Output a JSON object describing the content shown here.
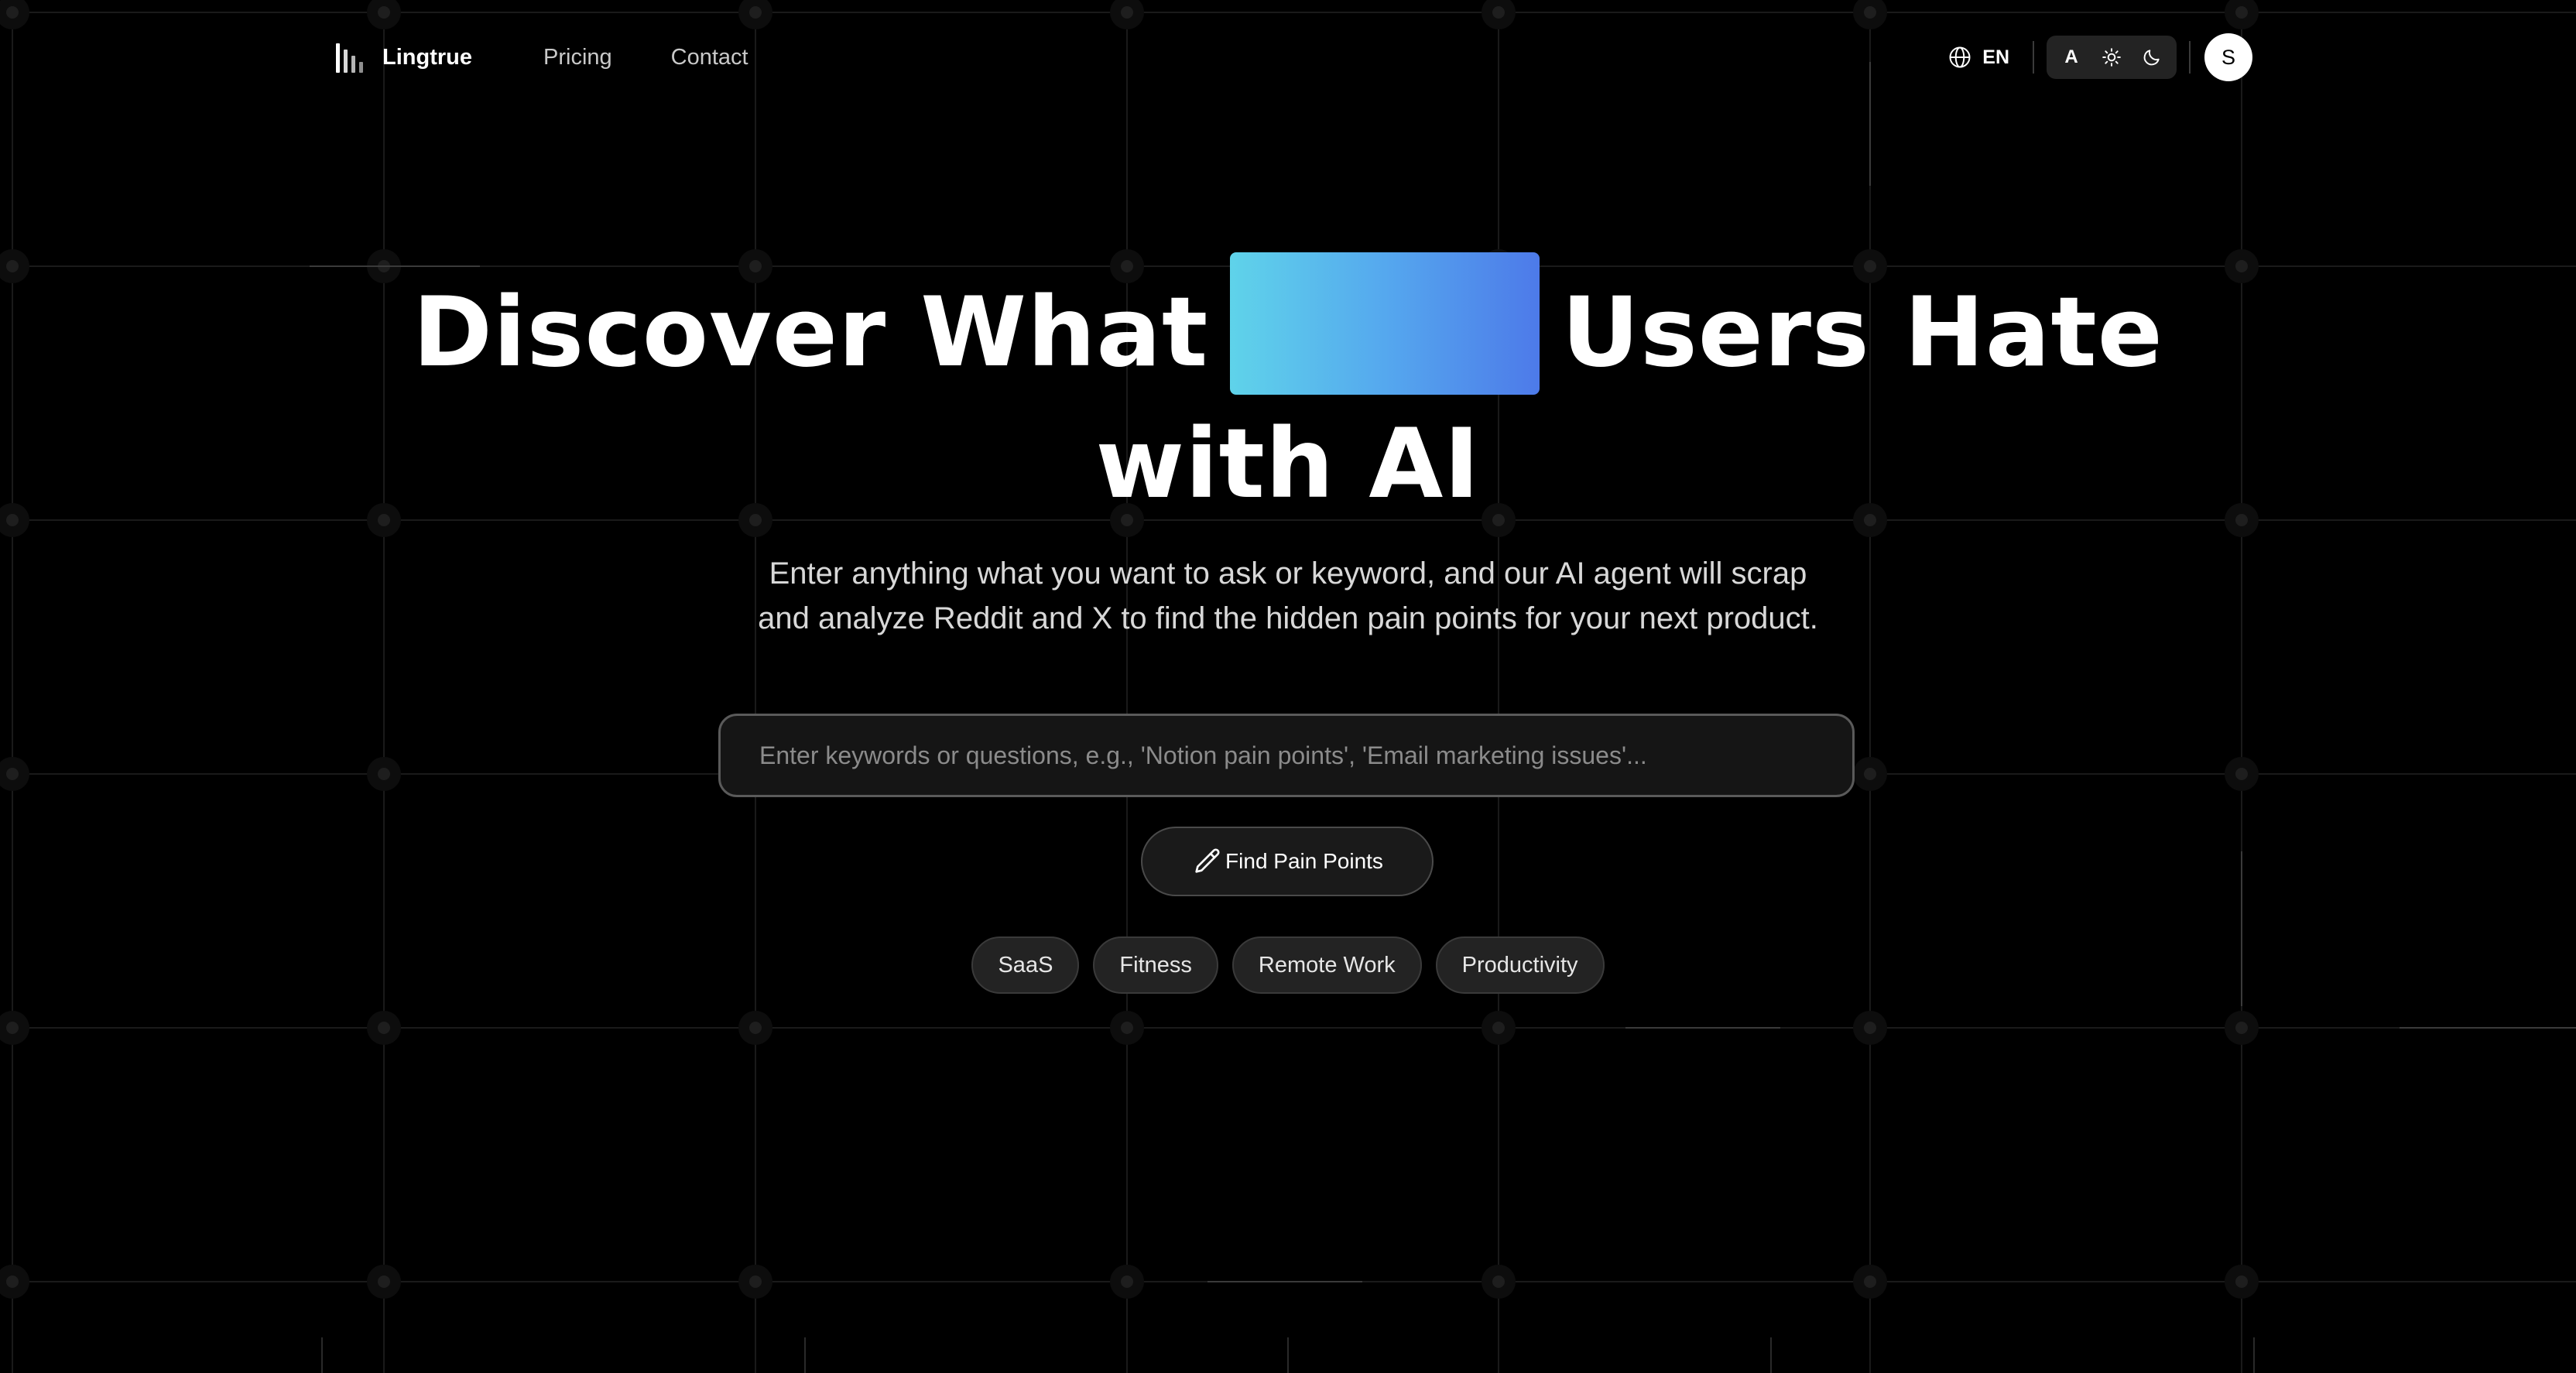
{
  "header": {
    "brand_name": "Lingtrue",
    "nav": [
      {
        "label": "Pricing"
      },
      {
        "label": "Contact"
      }
    ],
    "language": "EN",
    "theme_auto_label": "A",
    "avatar_initial": "S"
  },
  "hero": {
    "title_part1": "Discover What",
    "title_part2": "Users Hate",
    "title_line2": "with AI",
    "highlight_gradient": [
      "#5fd3ea",
      "#4d7ae9"
    ],
    "subtitle_line1": "Enter anything what you want to ask or keyword, and our AI agent will scrap",
    "subtitle_line2": "and analyze Reddit and X to find the hidden pain points for your next product."
  },
  "search": {
    "placeholder": "Enter keywords or questions, e.g., 'Notion pain points', 'Email marketing issues'...",
    "value": ""
  },
  "find_button": {
    "label": "Find Pain Points",
    "icon": "pencil-icon"
  },
  "chips": [
    {
      "label": "SaaS"
    },
    {
      "label": "Fitness"
    },
    {
      "label": "Remote Work"
    },
    {
      "label": "Productivity"
    }
  ],
  "colors": {
    "background": "#000000",
    "accent_start": "#5fd3ea",
    "accent_end": "#4d7ae9"
  }
}
